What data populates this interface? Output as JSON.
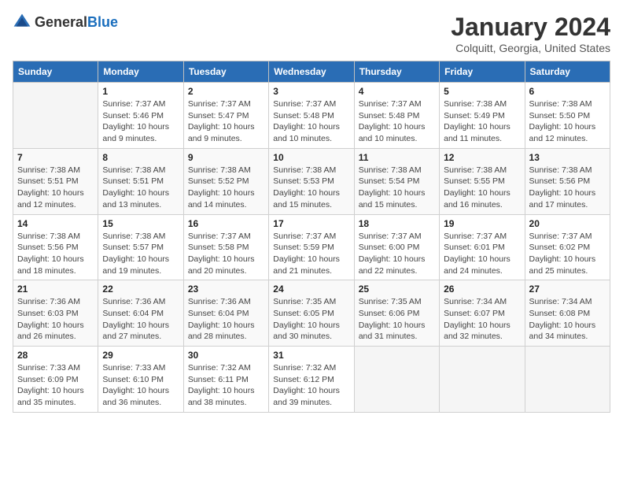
{
  "logo": {
    "general": "General",
    "blue": "Blue"
  },
  "title": "January 2024",
  "subtitle": "Colquitt, Georgia, United States",
  "days_of_week": [
    "Sunday",
    "Monday",
    "Tuesday",
    "Wednesday",
    "Thursday",
    "Friday",
    "Saturday"
  ],
  "weeks": [
    [
      {
        "day": "",
        "info": ""
      },
      {
        "day": "1",
        "info": "Sunrise: 7:37 AM\nSunset: 5:46 PM\nDaylight: 10 hours\nand 9 minutes."
      },
      {
        "day": "2",
        "info": "Sunrise: 7:37 AM\nSunset: 5:47 PM\nDaylight: 10 hours\nand 9 minutes."
      },
      {
        "day": "3",
        "info": "Sunrise: 7:37 AM\nSunset: 5:48 PM\nDaylight: 10 hours\nand 10 minutes."
      },
      {
        "day": "4",
        "info": "Sunrise: 7:37 AM\nSunset: 5:48 PM\nDaylight: 10 hours\nand 10 minutes."
      },
      {
        "day": "5",
        "info": "Sunrise: 7:38 AM\nSunset: 5:49 PM\nDaylight: 10 hours\nand 11 minutes."
      },
      {
        "day": "6",
        "info": "Sunrise: 7:38 AM\nSunset: 5:50 PM\nDaylight: 10 hours\nand 12 minutes."
      }
    ],
    [
      {
        "day": "7",
        "info": "Sunrise: 7:38 AM\nSunset: 5:51 PM\nDaylight: 10 hours\nand 12 minutes."
      },
      {
        "day": "8",
        "info": "Sunrise: 7:38 AM\nSunset: 5:51 PM\nDaylight: 10 hours\nand 13 minutes."
      },
      {
        "day": "9",
        "info": "Sunrise: 7:38 AM\nSunset: 5:52 PM\nDaylight: 10 hours\nand 14 minutes."
      },
      {
        "day": "10",
        "info": "Sunrise: 7:38 AM\nSunset: 5:53 PM\nDaylight: 10 hours\nand 15 minutes."
      },
      {
        "day": "11",
        "info": "Sunrise: 7:38 AM\nSunset: 5:54 PM\nDaylight: 10 hours\nand 15 minutes."
      },
      {
        "day": "12",
        "info": "Sunrise: 7:38 AM\nSunset: 5:55 PM\nDaylight: 10 hours\nand 16 minutes."
      },
      {
        "day": "13",
        "info": "Sunrise: 7:38 AM\nSunset: 5:56 PM\nDaylight: 10 hours\nand 17 minutes."
      }
    ],
    [
      {
        "day": "14",
        "info": "Sunrise: 7:38 AM\nSunset: 5:56 PM\nDaylight: 10 hours\nand 18 minutes."
      },
      {
        "day": "15",
        "info": "Sunrise: 7:38 AM\nSunset: 5:57 PM\nDaylight: 10 hours\nand 19 minutes."
      },
      {
        "day": "16",
        "info": "Sunrise: 7:37 AM\nSunset: 5:58 PM\nDaylight: 10 hours\nand 20 minutes."
      },
      {
        "day": "17",
        "info": "Sunrise: 7:37 AM\nSunset: 5:59 PM\nDaylight: 10 hours\nand 21 minutes."
      },
      {
        "day": "18",
        "info": "Sunrise: 7:37 AM\nSunset: 6:00 PM\nDaylight: 10 hours\nand 22 minutes."
      },
      {
        "day": "19",
        "info": "Sunrise: 7:37 AM\nSunset: 6:01 PM\nDaylight: 10 hours\nand 24 minutes."
      },
      {
        "day": "20",
        "info": "Sunrise: 7:37 AM\nSunset: 6:02 PM\nDaylight: 10 hours\nand 25 minutes."
      }
    ],
    [
      {
        "day": "21",
        "info": "Sunrise: 7:36 AM\nSunset: 6:03 PM\nDaylight: 10 hours\nand 26 minutes."
      },
      {
        "day": "22",
        "info": "Sunrise: 7:36 AM\nSunset: 6:04 PM\nDaylight: 10 hours\nand 27 minutes."
      },
      {
        "day": "23",
        "info": "Sunrise: 7:36 AM\nSunset: 6:04 PM\nDaylight: 10 hours\nand 28 minutes."
      },
      {
        "day": "24",
        "info": "Sunrise: 7:35 AM\nSunset: 6:05 PM\nDaylight: 10 hours\nand 30 minutes."
      },
      {
        "day": "25",
        "info": "Sunrise: 7:35 AM\nSunset: 6:06 PM\nDaylight: 10 hours\nand 31 minutes."
      },
      {
        "day": "26",
        "info": "Sunrise: 7:34 AM\nSunset: 6:07 PM\nDaylight: 10 hours\nand 32 minutes."
      },
      {
        "day": "27",
        "info": "Sunrise: 7:34 AM\nSunset: 6:08 PM\nDaylight: 10 hours\nand 34 minutes."
      }
    ],
    [
      {
        "day": "28",
        "info": "Sunrise: 7:33 AM\nSunset: 6:09 PM\nDaylight: 10 hours\nand 35 minutes."
      },
      {
        "day": "29",
        "info": "Sunrise: 7:33 AM\nSunset: 6:10 PM\nDaylight: 10 hours\nand 36 minutes."
      },
      {
        "day": "30",
        "info": "Sunrise: 7:32 AM\nSunset: 6:11 PM\nDaylight: 10 hours\nand 38 minutes."
      },
      {
        "day": "31",
        "info": "Sunrise: 7:32 AM\nSunset: 6:12 PM\nDaylight: 10 hours\nand 39 minutes."
      },
      {
        "day": "",
        "info": ""
      },
      {
        "day": "",
        "info": ""
      },
      {
        "day": "",
        "info": ""
      }
    ]
  ]
}
